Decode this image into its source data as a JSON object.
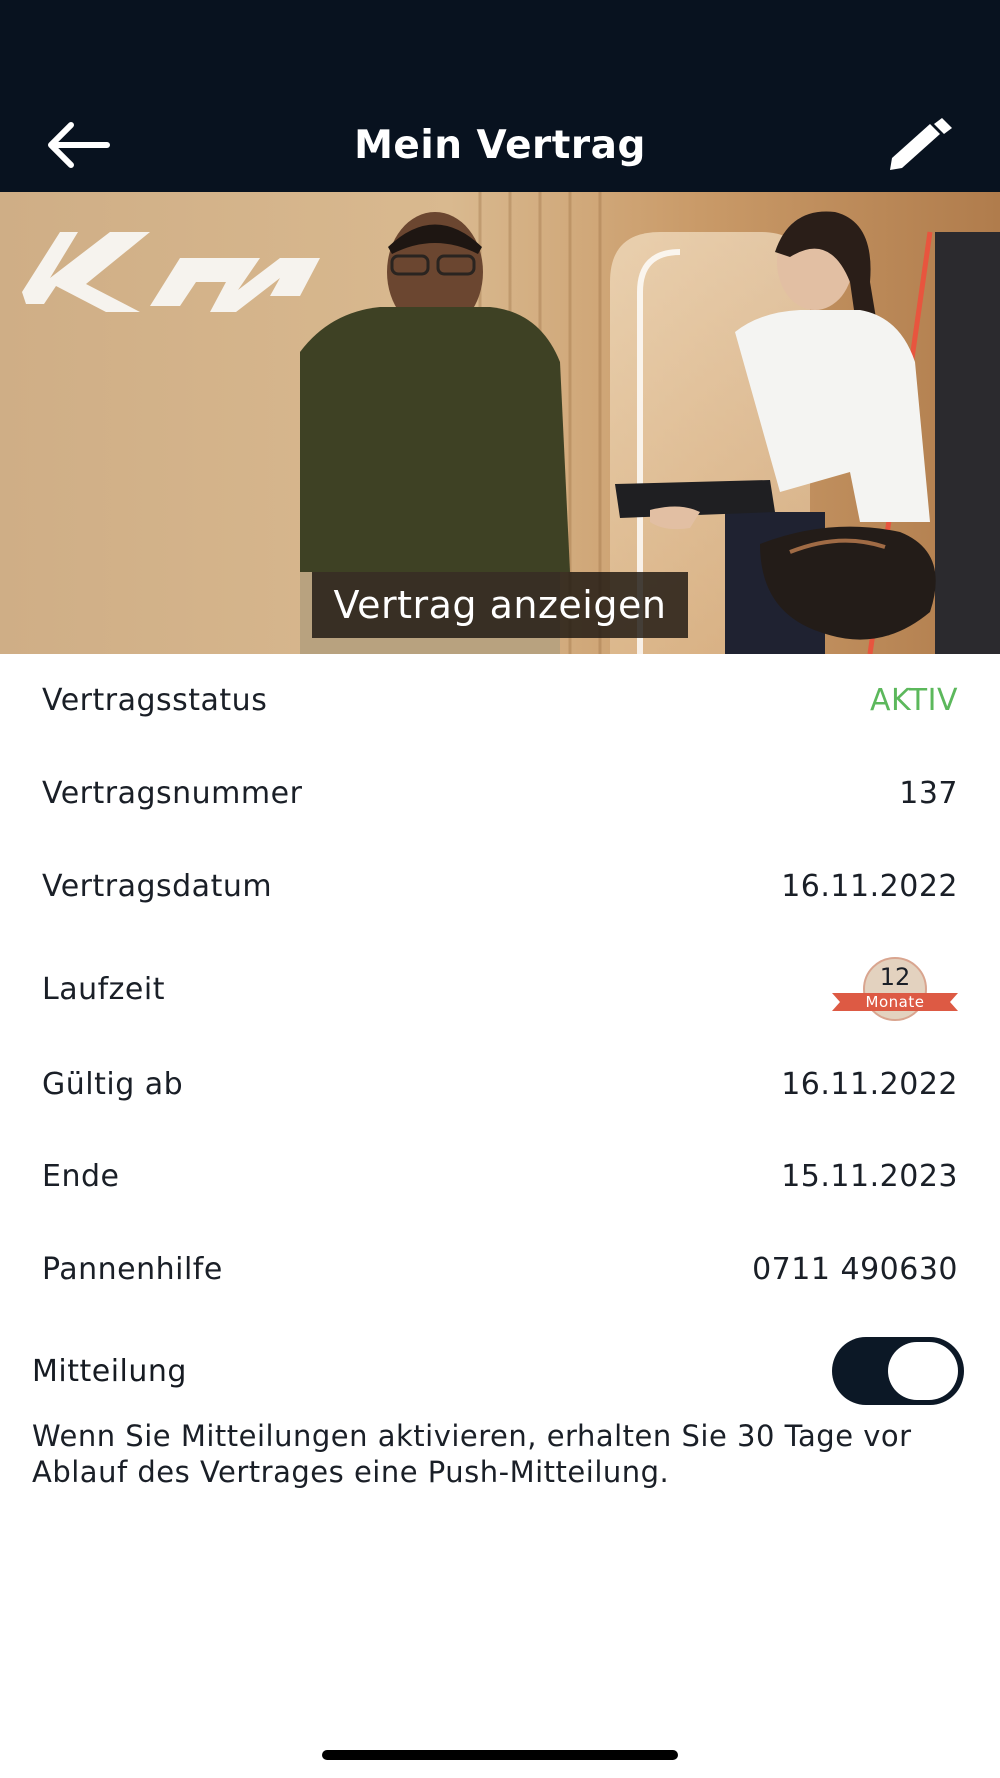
{
  "header": {
    "title": "Mein Vertrag",
    "back_icon": "arrow-left-icon",
    "edit_icon": "pencil-icon",
    "background": "#08121f"
  },
  "hero": {
    "caption": "Vertrag anzeigen"
  },
  "contract": {
    "status_label": "Vertragsstatus",
    "status_value": "AKTIV",
    "status_color": "#5cb85c",
    "number_label": "Vertragsnummer",
    "number_value": "137",
    "date_label": "Vertragsdatum",
    "date_value": "16.11.2022",
    "term_label": "Laufzeit",
    "term_badge_number": "12",
    "term_badge_unit": "Monate",
    "valid_from_label": "Gültig ab",
    "valid_from_value": "16.11.2022",
    "end_label": "Ende",
    "end_value": "15.11.2023",
    "roadside_label": "Pannenhilfe",
    "roadside_value": "0711 490630"
  },
  "notification": {
    "label": "Mitteilung",
    "enabled": true,
    "text": "Wenn Sie Mitteilungen aktivieren, erhalten Sie 30 Tage vor Ablauf des Vertrages eine Push-Mitteilung."
  }
}
